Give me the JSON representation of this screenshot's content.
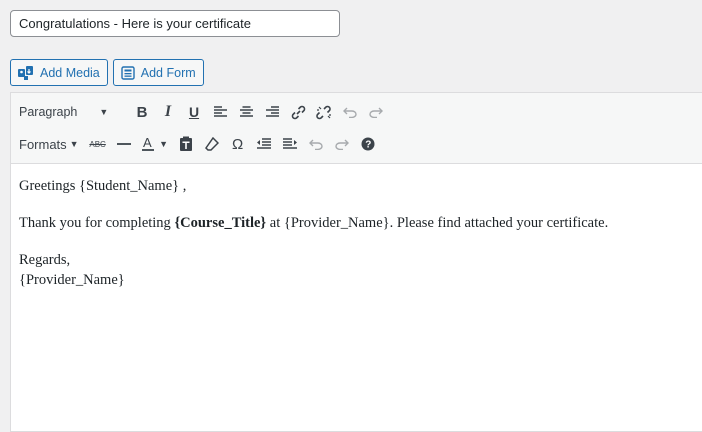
{
  "subject": {
    "value": "Congratulations - Here is your certificate"
  },
  "media_buttons": [
    {
      "label": "Add Media",
      "icon": "media-icon"
    },
    {
      "label": "Add Form",
      "icon": "form-icon"
    }
  ],
  "toolbar": {
    "format_select": "Paragraph",
    "formats_label": "Formats"
  },
  "content": {
    "greeting": "Greetings {Student_Name} ,",
    "thanks_prefix": "Thank you for completing ",
    "course_title": "{Course_Title}",
    "thanks_suffix": " at {Provider_Name}. Please find attached your certificate.",
    "regards": "Regards,",
    "signature": "{Provider_Name}"
  },
  "colors": {
    "accent": "#2271b1",
    "text": "#1d2327",
    "toolbar_bg": "#f6f7f7"
  }
}
